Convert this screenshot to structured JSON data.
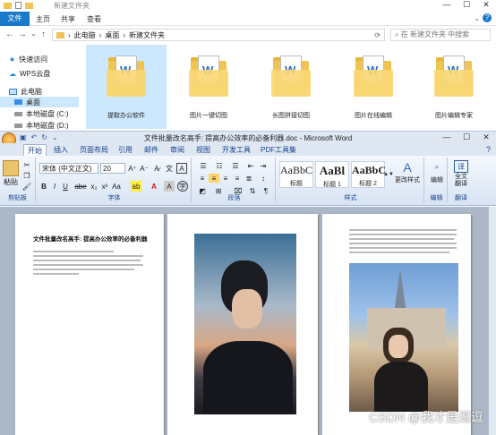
{
  "explorer": {
    "title": "新建文件夹",
    "tabs": [
      "文件",
      "主页",
      "共享",
      "查看"
    ],
    "breadcrumb": [
      "此电脑",
      "桌面",
      "新建文件夹"
    ],
    "search_placeholder": "在 新建文件夹 中搜索",
    "sidebar": [
      {
        "label": "快速访问",
        "icon": "star-icon"
      },
      {
        "label": "WPS云盘",
        "icon": "cloud-icon"
      },
      {
        "label": "此电脑",
        "icon": "pc-icon"
      },
      {
        "label": "桌面",
        "icon": "desktop-icon"
      },
      {
        "label": "本地磁盘 (C:)",
        "icon": "drive-icon"
      },
      {
        "label": "本地磁盘 (D:)",
        "icon": "drive-icon"
      }
    ],
    "files": [
      "提取办公软件",
      "图片一键切图",
      "长图拼接切图",
      "图片在线编辑",
      "图片编辑专家"
    ]
  },
  "word": {
    "title": "文件批量改名高手: 提高办公效率的必备利器.doc - Microsoft Word",
    "tabs": [
      "开始",
      "插入",
      "页面布局",
      "引用",
      "邮件",
      "审阅",
      "视图",
      "开发工具",
      "PDF工具集"
    ],
    "font_name": "宋体 (中文正文)",
    "font_size": "20",
    "groups": {
      "clipboard": "剪贴板",
      "font": "字体",
      "paragraph": "段落",
      "styles": "样式",
      "edit": "编辑",
      "translate": "翻译"
    },
    "paste": "粘贴",
    "styles": [
      {
        "preview": "AaBbC",
        "name": "标题"
      },
      {
        "preview": "AaBl",
        "name": "标题 1"
      },
      {
        "preview": "AaBbC",
        "name": "标题 2"
      }
    ],
    "change_style": "更改样式",
    "edit_label": "编辑",
    "translate_label": "全文\n翻译",
    "doc_heading": "文件批量改名高手: 提高办公效率的必备利器"
  },
  "watermark": "CSDN @我才是逗逗"
}
